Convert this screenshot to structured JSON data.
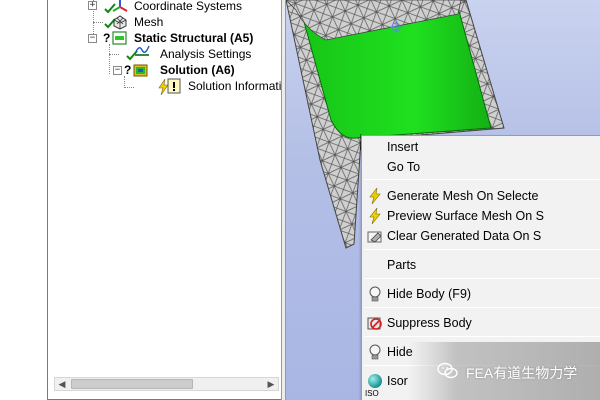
{
  "tree": {
    "items": [
      {
        "label": "Coordinate Systems",
        "bold": false,
        "icon": "coordinate-systems-icon",
        "status": "check-icon"
      },
      {
        "label": "Mesh",
        "bold": false,
        "icon": "mesh-icon",
        "status": "check-icon"
      },
      {
        "label": "Static Structural (A5)",
        "bold": true,
        "icon": "static-structural-icon",
        "status": "question-icon"
      },
      {
        "label": "Analysis Settings",
        "bold": false,
        "icon": "analysis-settings-icon",
        "status": "check-icon"
      },
      {
        "label": "Solution (A6)",
        "bold": true,
        "icon": "solution-icon",
        "status": "question-icon"
      },
      {
        "label": "Solution Informatio",
        "bold": false,
        "icon": "solution-information-icon",
        "status": "lightning-icon"
      }
    ]
  },
  "context_menu": {
    "items": [
      {
        "label": "Insert",
        "icon": "pointer-arrow-icon"
      },
      {
        "label": "Go To",
        "icon": ""
      },
      {
        "label": "Generate Mesh On Selecte",
        "icon": "lightning-icon"
      },
      {
        "label": "Preview Surface Mesh On S",
        "icon": "lightning-icon"
      },
      {
        "label": "Clear Generated Data On S",
        "icon": "eraser-icon"
      },
      {
        "label": "Parts",
        "icon": ""
      },
      {
        "label": "Hide Body (F9)",
        "icon": "lightbulb-icon"
      },
      {
        "label": "Suppress Body",
        "icon": "suppress-icon"
      },
      {
        "label": "Hide",
        "icon": "lightbulb-icon"
      },
      {
        "label": "Isor",
        "icon": "sphere-icon"
      }
    ],
    "iso_fragment": "ISO"
  },
  "watermark": {
    "text": "FEA有道生物力学",
    "icon": "wechat-icon"
  },
  "colors": {
    "model_green": "#1ad41a",
    "viewport_top": "#c9d2ee",
    "viewport_bottom": "#a9b6e4",
    "menu_bg": "#f2f2f2",
    "bolt_yellow": "#f0d000"
  }
}
